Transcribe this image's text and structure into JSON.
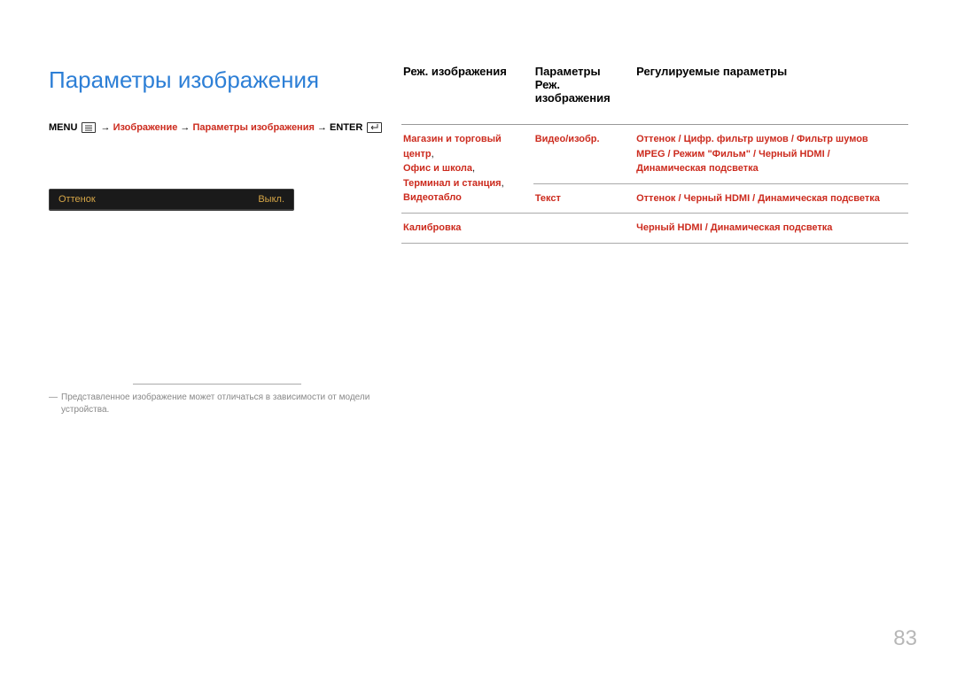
{
  "title": "Параметры изображения",
  "breadcrumb": {
    "menu": "MENU",
    "p1": "Изображение",
    "p2": "Параметры изображения",
    "enter": "ENTER"
  },
  "osd": {
    "label": "Оттенок",
    "value": "Выкл."
  },
  "footnote": "Представленное изображение может отличаться в зависимости от модели устройства.",
  "table": {
    "head": {
      "c1": "Реж. изображения",
      "c2": "Параметры Реж. изображения",
      "c3": "Регулируемые параметры"
    },
    "r1": {
      "c1a": "Магазин и торговый центр",
      "c1b": "Офис и школа",
      "c1c": "Терминал и станция",
      "c1d": "Видеотабло",
      "c2": "Видео/изобр.",
      "c3": "Оттенок / Цифр. фильтр шумов / Фильтр шумов MPEG / Режим \"Фильм\" / Черный HDMI / Динамическая подсветка"
    },
    "r2": {
      "c2": "Текст",
      "c3": "Оттенок / Черный HDMI / Динамическая подсветка"
    },
    "r3": {
      "c1": "Калибровка",
      "c3": "Черный HDMI / Динамическая подсветка"
    }
  },
  "page_number": "83"
}
